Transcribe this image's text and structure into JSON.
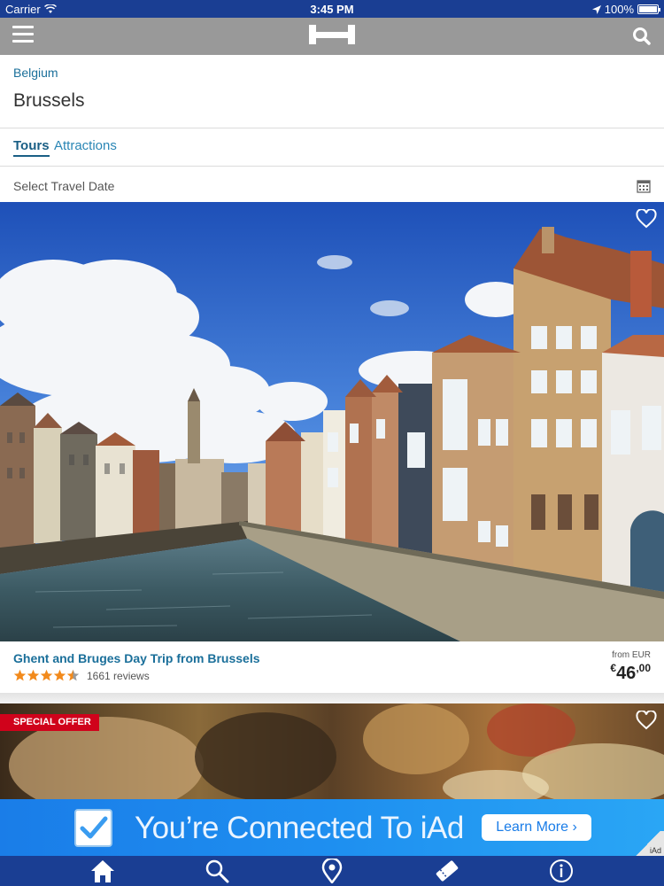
{
  "status_bar": {
    "carrier": "Carrier",
    "time": "3:45 PM",
    "battery": "100%",
    "battery_level": 1.0
  },
  "nav": {
    "menu_icon": "hamburger-menu-icon",
    "logo_icon": "hotels-h-logo",
    "search_icon": "search-icon"
  },
  "header": {
    "country": "Belgium",
    "city": "Brussels"
  },
  "tabs": [
    {
      "label": "Tours",
      "active": true
    },
    {
      "label": "Attractions",
      "active": false
    }
  ],
  "date_picker": {
    "label": "Select Travel Date",
    "icon": "calendar-icon"
  },
  "tours": [
    {
      "title": "Ghent and Bruges Day Trip from Brussels",
      "rating": 4.5,
      "reviews": "1661 reviews",
      "price_from": "from EUR",
      "price_currency": "€",
      "price_integer": "46",
      "price_decimal": ",00",
      "favorite_icon": "heart-icon"
    },
    {
      "badge": "SPECIAL OFFER",
      "favorite_icon": "heart-icon"
    }
  ],
  "ad_banner": {
    "text": "You’re Connected To iAd",
    "button": "Learn More ›",
    "tag": "iAd"
  },
  "tab_bar": [
    "home-icon",
    "search-icon",
    "location-pin-icon",
    "ticket-icon",
    "info-icon"
  ],
  "colors": {
    "status_bar": "#1a3e93",
    "nav_bar": "#999999",
    "link": "#1a6f9a",
    "star": "#f28a1c",
    "badge": "#d0021b",
    "ad_blue": "#1e8ff0"
  }
}
